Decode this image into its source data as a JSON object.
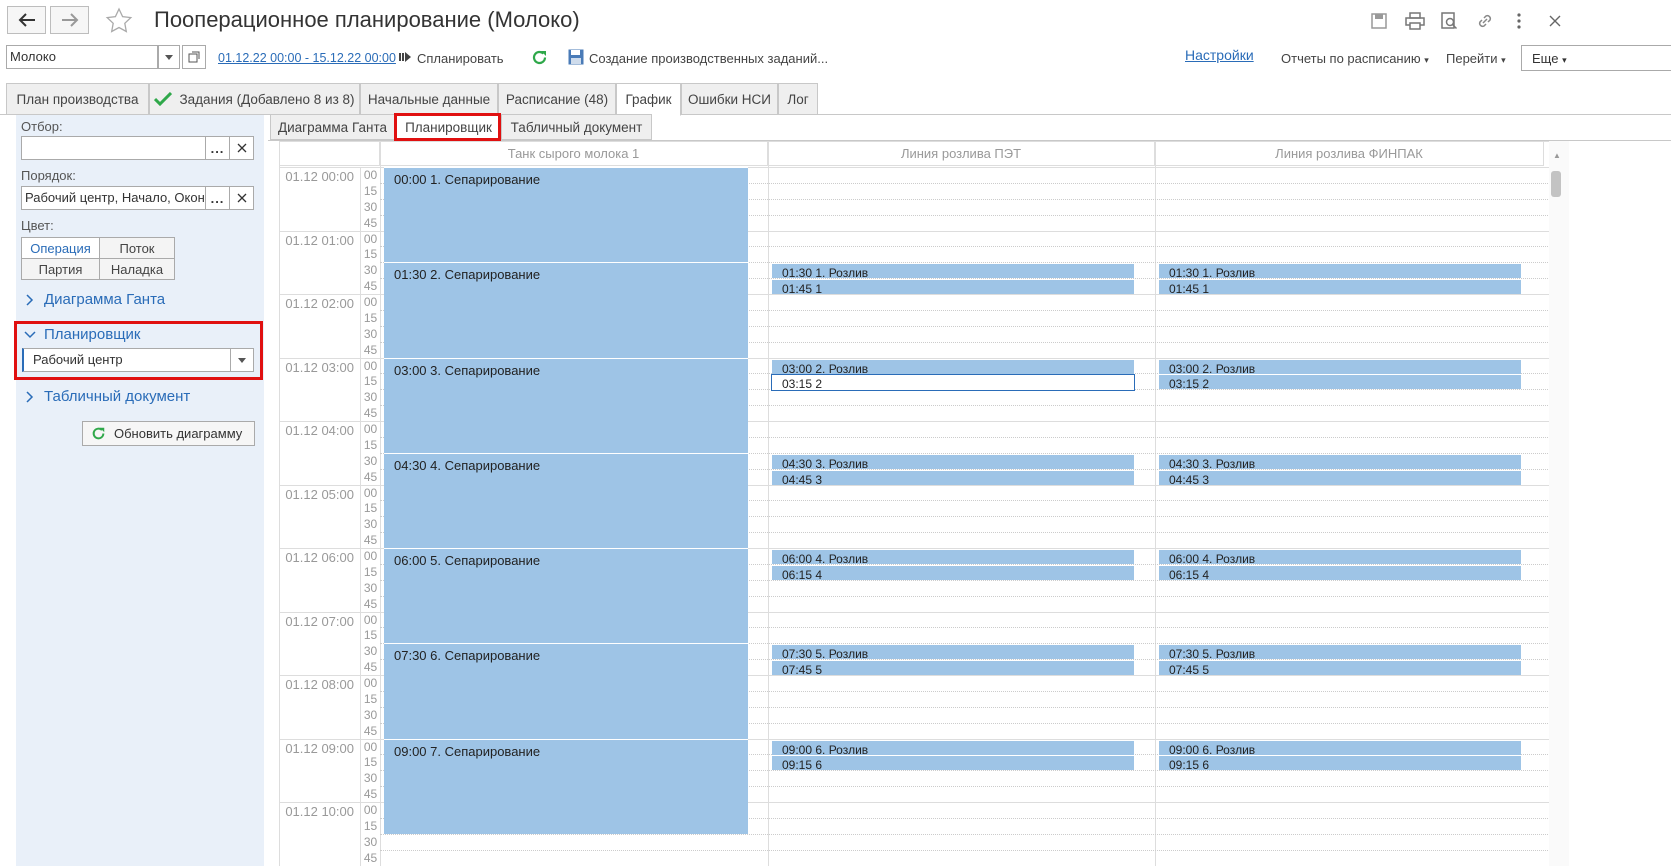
{
  "window": {
    "title": "Пооперационное планирование (Молоко)"
  },
  "toolbar": {
    "product_value": "Молоко",
    "period_link": "01.12.22 00:00 - 15.12.22 00:00",
    "plan_button": "Спланировать",
    "create_tasks_button": "Создание производственных заданий...",
    "settings_link": "Настройки",
    "reports_menu": "Отчеты по расписанию",
    "goto_menu": "Перейти",
    "more_menu": "Еще"
  },
  "tabs": [
    {
      "label": "План производства"
    },
    {
      "label": "Задания (Добавлено 8 из 8)"
    },
    {
      "label": "Начальные данные"
    },
    {
      "label": "Расписание (48)"
    },
    {
      "label": "График"
    },
    {
      "label": "Ошибки НСИ"
    },
    {
      "label": "Лог"
    }
  ],
  "left": {
    "filter_label": "Отбор:",
    "filter_value": "",
    "order_label": "Порядок:",
    "order_value": "Рабочий центр, Начало, Окон",
    "color_label": "Цвет:",
    "color_options": [
      "Операция",
      "Поток",
      "Партия",
      "Наладка"
    ],
    "groups": {
      "gantt": "Диаграмма Ганта",
      "planner": "Планировщик",
      "table": "Табличный документ"
    },
    "planner_select": "Рабочий центр",
    "refresh_button": "Обновить диаграмму"
  },
  "subtabs": [
    "Диаграмма Ганта",
    "Планировщик",
    "Табличный документ"
  ],
  "planner": {
    "columns": [
      "Танк сырого молока  1",
      "Линия розлива ПЭТ",
      "Линия розлива ФИНПАК"
    ],
    "hours": [
      "01.12 00:00",
      "01.12 01:00",
      "01.12 02:00",
      "01.12 03:00",
      "01.12 04:00",
      "01.12 05:00",
      "01.12 06:00",
      "01.12 07:00",
      "01.12 08:00",
      "01.12 09:00",
      "01.12 10:00"
    ],
    "minutes": [
      "00",
      "15",
      "30",
      "45"
    ],
    "separations": [
      "00:00 1. Сепарирование",
      "01:30 2. Сепарирование",
      "03:00 3. Сепарирование",
      "04:30 4. Сепарирование",
      "06:00 5. Сепарирование",
      "07:30 6. Сепарирование",
      "09:00 7. Сепарирование"
    ],
    "fillings_a": [
      "01:30 1. Розлив",
      "03:00 2. Розлив",
      "04:30 3. Розлив",
      "06:00 4. Розлив",
      "07:30 5. Розлив",
      "09:00 6. Розлив"
    ],
    "fillings_b": [
      "01:45 1",
      "03:15 2",
      "04:45 3",
      "06:15 4",
      "07:45 5",
      "09:15 6"
    ]
  }
}
